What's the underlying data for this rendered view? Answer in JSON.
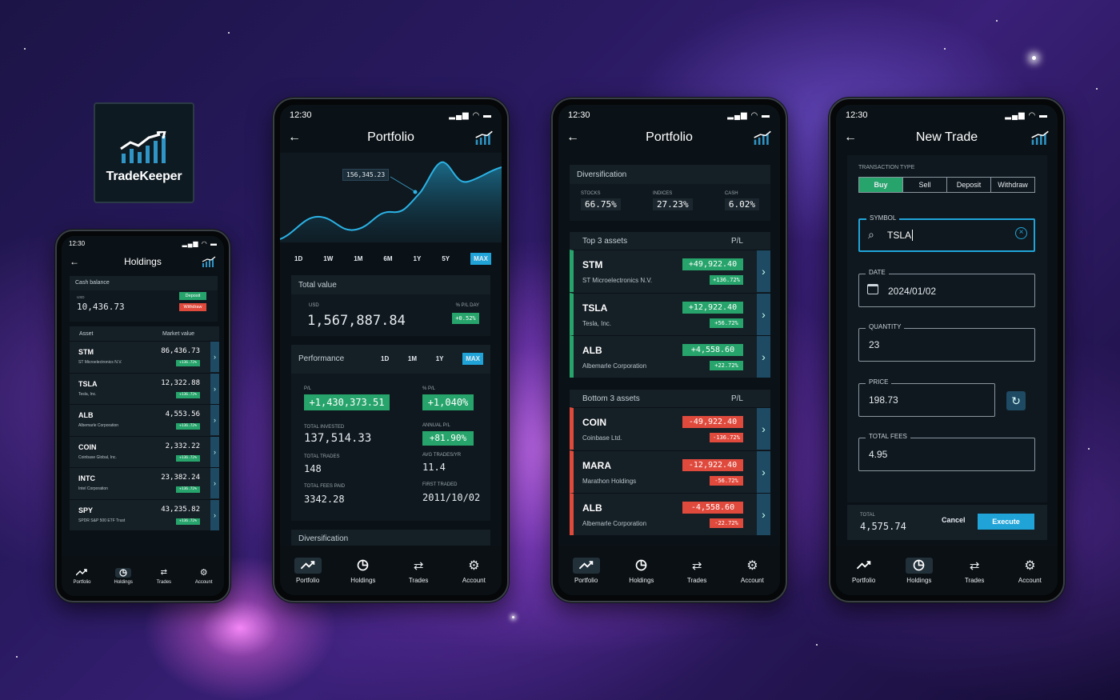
{
  "brand": {
    "name": "TradeKeeper"
  },
  "colors": {
    "green": "#27a46b",
    "red": "#e04a3d",
    "accent": "#20a4d8",
    "screen": "#0b1217",
    "card": "#151f26"
  },
  "status": {
    "time": "12:30"
  },
  "nav": [
    "Portfolio",
    "Holdings",
    "Trades",
    "Account"
  ],
  "holdings": {
    "title": "Holdings",
    "cash_label": "Cash balance",
    "currency": "USD",
    "cash_value": "10,436.73",
    "deposit": "Deposit",
    "withdraw": "Withdraw",
    "col_asset": "Asset",
    "col_value": "Market value",
    "rows": [
      {
        "sym": "STM",
        "name": "ST Microelectronics N.V.",
        "value": "86,436.73",
        "pct": "+136.72%"
      },
      {
        "sym": "TSLA",
        "name": "Tesla, Inc.",
        "value": "12,322.88",
        "pct": "+136.72%"
      },
      {
        "sym": "ALB",
        "name": "Albemarle Corporation",
        "value": "4,553.56",
        "pct": "+136.72%"
      },
      {
        "sym": "COIN",
        "name": "Coinbase Global, Inc.",
        "value": "2,332.22",
        "pct": "+136.72%"
      },
      {
        "sym": "INTC",
        "name": "Intel Corporation",
        "value": "23,382.24",
        "pct": "+136.72%"
      },
      {
        "sym": "SPY",
        "name": "SPDR S&P 500 ETF Trust",
        "value": "43,235.82",
        "pct": "+136.72%"
      }
    ]
  },
  "portfolio": {
    "title": "Portfolio",
    "tooltip": "156,345.23",
    "ranges": [
      "1D",
      "1W",
      "1M",
      "6M",
      "1Y",
      "5Y",
      "MAX"
    ],
    "total_value_label": "Total value",
    "currency": "USD",
    "total_value": "1,567,887.84",
    "pl_day_label": "% P/L DAY",
    "pl_day": "+0.52%",
    "performance_label": "Performance",
    "perf_ranges": [
      "1D",
      "1M",
      "1Y",
      "MAX"
    ],
    "pl_label": "P/L",
    "pl_value": "+1,430,373.51",
    "pct_pl_label": "% P/L",
    "pct_pl_value": "+1,040%",
    "invested_label": "TOTAL INVESTED",
    "invested_value": "137,514.33",
    "annual_label": "ANNUAL P/L",
    "annual_value": "+81.90%",
    "trades_label": "TOTAL TRADES",
    "trades_value": "148",
    "avg_label": "AVG TRADES/YR",
    "avg_value": "11.4",
    "fees_label": "TOTAL FEES PAID",
    "fees_value": "3342.28",
    "first_label": "FIRST TRADED",
    "first_value": "2011/10/02",
    "diversification_label": "Diversification"
  },
  "portfolio2": {
    "title": "Portfolio",
    "diversification_label": "Diversification",
    "div": [
      {
        "k": "STOCKS",
        "v": "66.75%"
      },
      {
        "k": "INDICES",
        "v": "27.23%"
      },
      {
        "k": "CASH",
        "v": "6.02%"
      }
    ],
    "top_label": "Top 3 assets",
    "bottom_label": "Bottom 3 assets",
    "pl_col": "P/L",
    "top": [
      {
        "sym": "STM",
        "name": "ST Microelectronics N.V.",
        "pl": "+49,922.40",
        "pct": "+136.72%"
      },
      {
        "sym": "TSLA",
        "name": "Tesla, Inc.",
        "pl": "+12,922.40",
        "pct": "+56.72%"
      },
      {
        "sym": "ALB",
        "name": "Albemarle Corporation",
        "pl": "+4,558.60",
        "pct": "+22.72%"
      }
    ],
    "bottom": [
      {
        "sym": "COIN",
        "name": "Coinbase Ltd.",
        "pl": "-49,922.40",
        "pct": "-136.72%"
      },
      {
        "sym": "MARA",
        "name": "Marathon Holdings",
        "pl": "-12,922.40",
        "pct": "-56.72%"
      },
      {
        "sym": "ALB",
        "name": "Albemarle Corporation",
        "pl": "-4,558.60",
        "pct": "-22.72%"
      }
    ]
  },
  "trade": {
    "title": "New Trade",
    "type_label": "TRANSACTION TYPE",
    "types": [
      "Buy",
      "Sell",
      "Deposit",
      "Withdraw"
    ],
    "symbol_label": "SYMBOL",
    "symbol_value": "TSLA",
    "date_label": "DATE",
    "date_value": "2024/01/02",
    "qty_label": "QUANTITY",
    "qty_value": "23",
    "price_label": "PRICE",
    "price_value": "198.73",
    "fees_label": "TOTAL FEES",
    "fees_value": "4.95",
    "total_label": "TOTAL",
    "total_value": "4,575.74",
    "cancel": "Cancel",
    "execute": "Execute"
  }
}
